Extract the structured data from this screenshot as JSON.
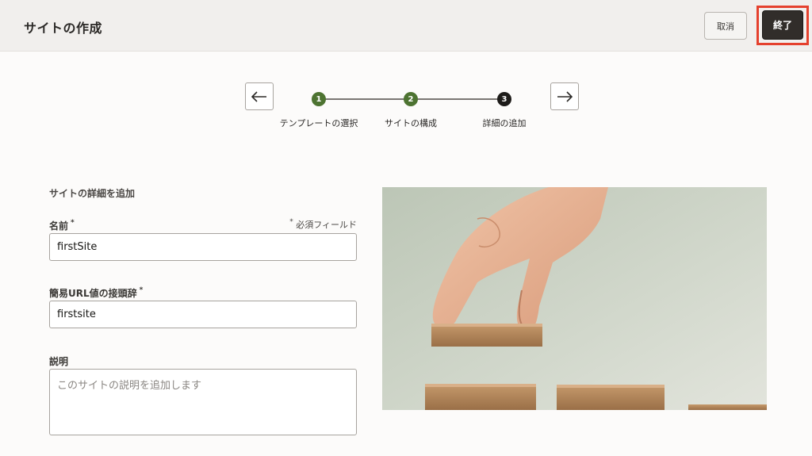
{
  "header": {
    "title": "サイトの作成",
    "cancel_label": "取消",
    "finish_label": "終了"
  },
  "wizard": {
    "steps": [
      {
        "number": "1",
        "label": "テンプレートの選択",
        "status": "complete"
      },
      {
        "number": "2",
        "label": "サイトの構成",
        "status": "complete"
      },
      {
        "number": "3",
        "label": "詳細の追加",
        "status": "current"
      }
    ]
  },
  "form": {
    "section_title": "サイトの詳細を追加",
    "required_note": "必須フィールド",
    "name": {
      "label": "名前",
      "value": "firstSite"
    },
    "url_prefix": {
      "label": "簡易URL値の接頭辞",
      "value": "firstsite"
    },
    "description": {
      "label": "説明",
      "placeholder": "このサイトの説明を追加します"
    }
  },
  "colors": {
    "accent_complete": "#4d7331",
    "accent_current": "#1d1b19",
    "highlight": "#e5412e"
  }
}
